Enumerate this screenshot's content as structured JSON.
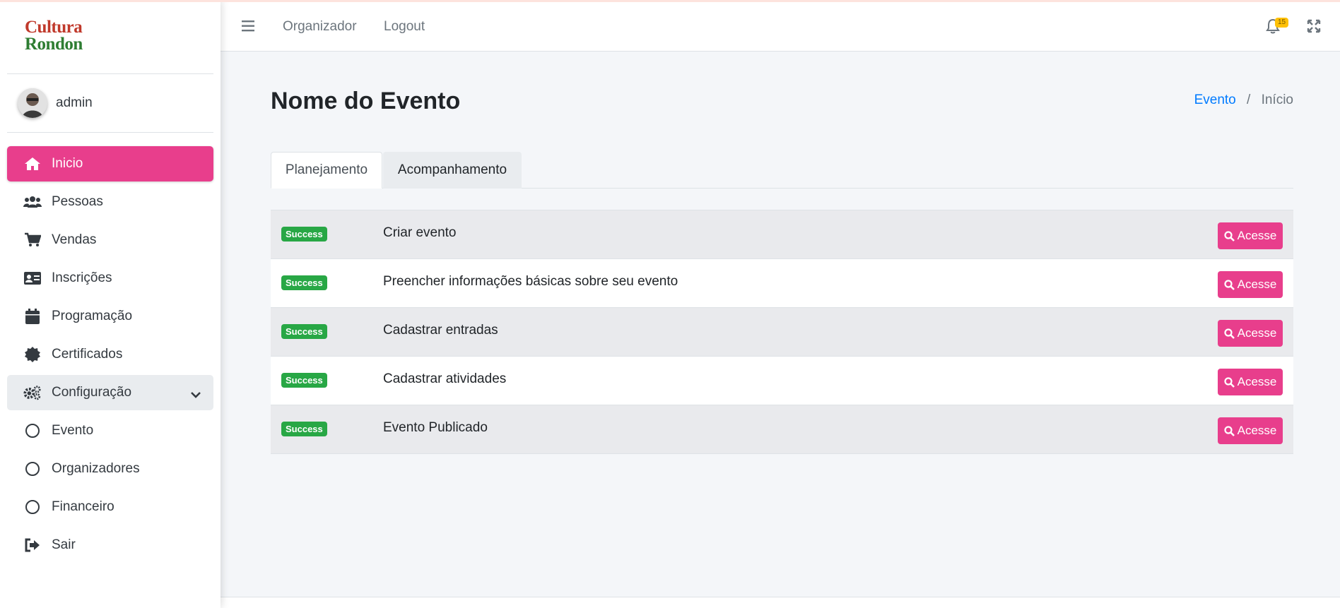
{
  "brand": {
    "line1": "Cultura",
    "line2": "Rondon"
  },
  "user": {
    "name": "admin"
  },
  "sidebar": {
    "items": [
      {
        "label": "Inicio",
        "icon": "home-icon"
      },
      {
        "label": "Pessoas",
        "icon": "users-icon"
      },
      {
        "label": "Vendas",
        "icon": "cart-icon"
      },
      {
        "label": "Inscrições",
        "icon": "id-card-icon"
      },
      {
        "label": "Programação",
        "icon": "calendar-icon"
      },
      {
        "label": "Certificados",
        "icon": "certificate-icon"
      },
      {
        "label": "Configuração",
        "icon": "gears-icon"
      },
      {
        "label": "Evento",
        "icon": "circle-icon"
      },
      {
        "label": "Organizadores",
        "icon": "circle-icon"
      },
      {
        "label": "Financeiro",
        "icon": "circle-icon"
      },
      {
        "label": "Sair",
        "icon": "sign-out-icon"
      }
    ]
  },
  "header": {
    "links": [
      "Organizador",
      "Logout"
    ],
    "notifications_count": "15"
  },
  "main": {
    "title": "Nome do Evento",
    "breadcrumb": {
      "link": "Evento",
      "current": "Início"
    },
    "tabs": [
      {
        "label": "Planejamento",
        "active": true
      },
      {
        "label": "Acompanhamento",
        "active": false
      }
    ],
    "tasks": [
      {
        "status": "Success",
        "label": "Criar evento",
        "action": "Acesse"
      },
      {
        "status": "Success",
        "label": "Preencher informações básicas sobre seu evento",
        "action": "Acesse"
      },
      {
        "status": "Success",
        "label": "Cadastrar entradas",
        "action": "Acesse"
      },
      {
        "status": "Success",
        "label": "Cadastrar atividades",
        "action": "Acesse"
      },
      {
        "status": "Success",
        "label": "Evento Publicado",
        "action": "Acesse"
      }
    ]
  },
  "colors": {
    "accent": "#e83e8c",
    "success": "#28a745",
    "link": "#007bff",
    "badge_warning": "#ffc107"
  }
}
